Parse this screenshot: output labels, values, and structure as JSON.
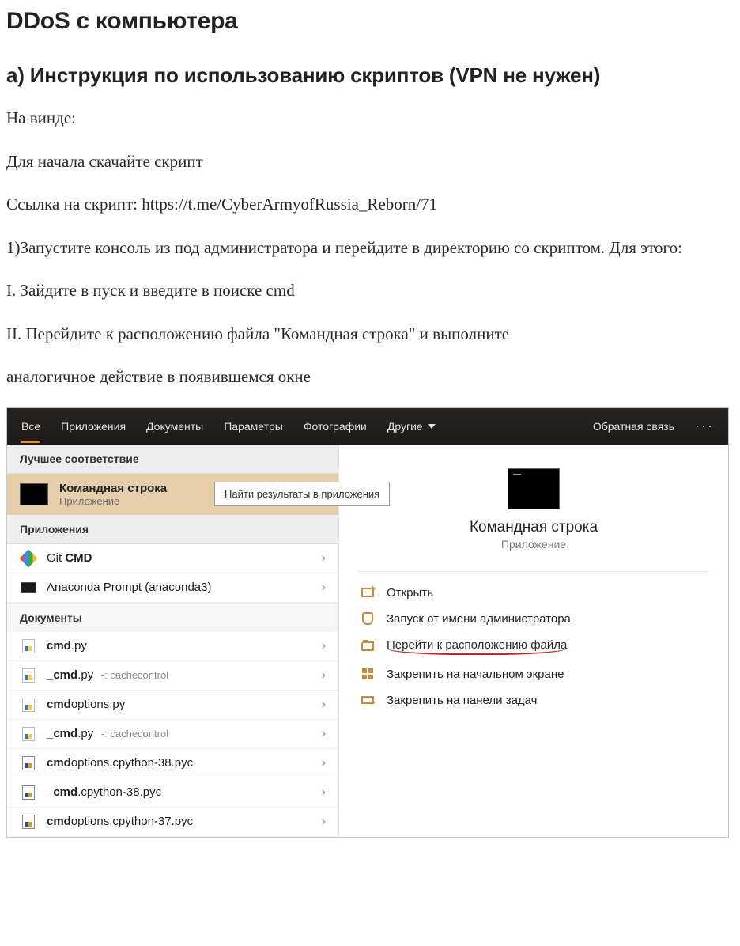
{
  "article": {
    "h1": "DDoS с компьютера",
    "h2": "а) Инструкция по использованию скриптов (VPN не нужен)",
    "p1": "На винде:",
    "p2": "Для начала скачайте скрипт",
    "p3": "Ссылка на скрипт: https://t.me/CyberArmyofRussia_Reborn/71",
    "p4": "1)Запустите консоль из под администратора и перейдите в директорию со скриптом. Для этого:",
    "p5": "I. Зайдите в пуск и введите в поиске cmd",
    "p6": "II. Перейдите к расположению файла \"Командная строка\" и выполните",
    "p7": "аналогичное действие в появившемся окне"
  },
  "search": {
    "tabs": {
      "all": "Все",
      "apps": "Приложения",
      "docs": "Документы",
      "params": "Параметры",
      "photos": "Фотографии",
      "other": "Другие"
    },
    "feedback": "Обратная связь",
    "best_header": "Лучшее соответствие",
    "best_title": "Командная строка",
    "best_sub": "Приложение",
    "tooltip": "Найти результаты в приложения",
    "apps_header": "Приложения",
    "app_rows": [
      {
        "prefix": "Git ",
        "bold": "CMD",
        "suffix": ""
      },
      {
        "prefix": "Anaconda Prompt (anaconda3)",
        "bold": "",
        "suffix": ""
      }
    ],
    "docs_header": "Документы",
    "doc_rows": [
      {
        "bold": "cmd",
        "rest": ".py",
        "meta": "",
        "type": "py"
      },
      {
        "bold": "_cmd",
        "rest": ".py",
        "meta": " -: cachecontrol",
        "type": "py"
      },
      {
        "bold": "cmd",
        "rest": "options.py",
        "meta": "",
        "type": "py"
      },
      {
        "bold": "_cmd",
        "rest": ".py",
        "meta": " -: cachecontrol",
        "type": "py"
      },
      {
        "bold": "cmd",
        "rest": "options.cpython-38.pyc",
        "meta": "",
        "type": "pyc"
      },
      {
        "bold": "_cmd",
        "rest": ".cpython-38.pyc",
        "meta": "",
        "type": "pyc"
      },
      {
        "bold": "cmd",
        "rest": "options.cpython-37.pyc",
        "meta": "",
        "type": "pyc"
      }
    ],
    "preview": {
      "title": "Командная строка",
      "sub": "Приложение"
    },
    "actions": {
      "open": "Открыть",
      "admin": "Запуск от имени администратора",
      "goto": "Перейти к расположению файла",
      "pin_start": "Закрепить на начальном экране",
      "pin_task": "Закрепить на панели задач"
    }
  }
}
